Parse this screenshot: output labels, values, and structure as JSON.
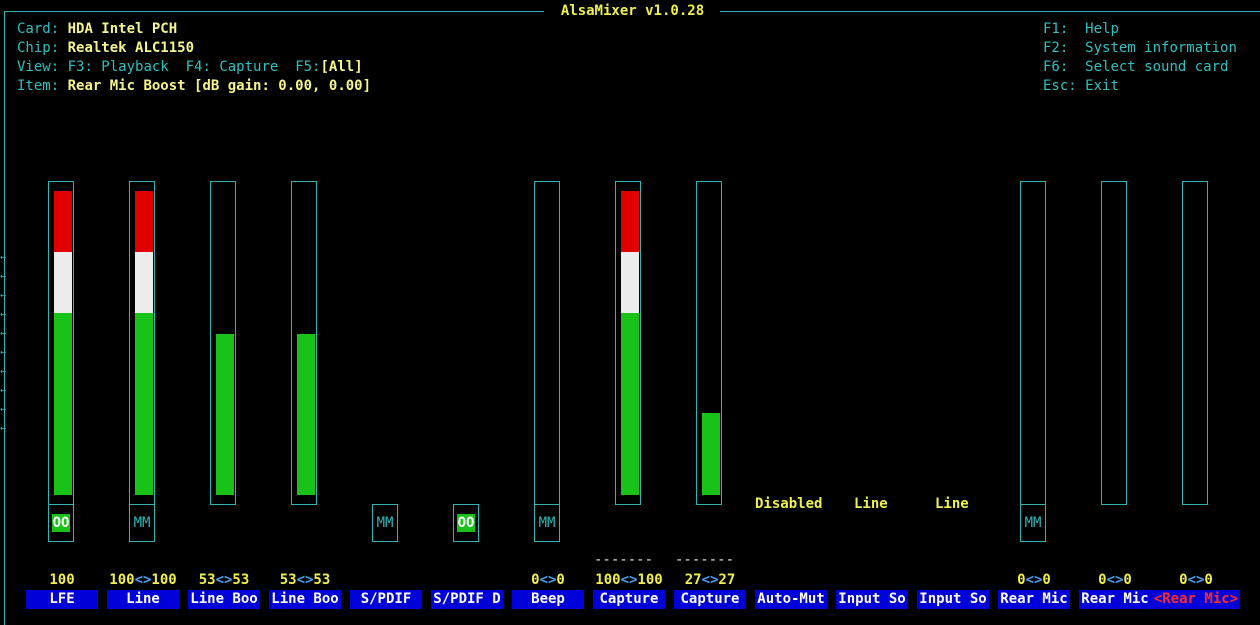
{
  "window": {
    "title": "AlsaMixer v1.0.28"
  },
  "info": {
    "card_label": "Card:",
    "card_value": "HDA Intel PCH",
    "chip_label": "Chip:",
    "chip_value": "Realtek ALC1150",
    "view_label": "View:",
    "view_playback": "F3: Playback",
    "view_capture": "F4: Capture",
    "view_all_key": "F5:",
    "view_all_value": "[All]",
    "item_label": "Item:",
    "item_value": "Rear Mic Boost [dB gain: 0.00, 0.00]"
  },
  "help": [
    {
      "key": "F1:",
      "text": "Help"
    },
    {
      "key": "F2:",
      "text": "System information"
    },
    {
      "key": "F6:",
      "text": "Select sound card"
    },
    {
      "key": "Esc:",
      "text": "Exit"
    }
  ],
  "scroll_mark": "←",
  "colors": {
    "frame": "#2fb4b4",
    "red": "#e00000",
    "white": "#ececec",
    "green": "#19c219",
    "label_bg": "#0000d8",
    "value": "#f0f04a"
  },
  "channels": [
    {
      "label": "LFE",
      "volume": "100",
      "level": 1.0
    },
    {
      "label": "Line",
      "vol_left": "100",
      "vol_sep": "<>",
      "vol_right": "100",
      "level": 1.0
    },
    {
      "label": "Line Boo",
      "vol_left": "53",
      "vol_sep": "<>",
      "vol_right": "53",
      "level": 0.53
    },
    {
      "label": "Line Boo",
      "vol_left": "53",
      "vol_sep": "<>",
      "vol_right": "53",
      "level": 0.53
    },
    {
      "label": "S/PDIF",
      "switch": "MM"
    },
    {
      "label": "S/PDIF D",
      "switch": "OO"
    },
    {
      "label": "Beep",
      "vol_left": "0",
      "vol_sep": "<>",
      "vol_right": "0",
      "level": 0.0
    },
    {
      "label": "Capture",
      "vol_left": "100",
      "vol_sep": "<>",
      "vol_right": "100",
      "level": 1.0,
      "capture_mark": "-------"
    },
    {
      "label": "Capture",
      "vol_left": "27",
      "vol_sep": "<>",
      "vol_right": "27",
      "level": 0.27,
      "capture_mark": "-------"
    },
    {
      "label": "Auto-Mut",
      "enum": "Disabled"
    },
    {
      "label": "Input So",
      "enum": "Line"
    },
    {
      "label": "Input So",
      "enum": "Line"
    },
    {
      "label": "Rear Mic",
      "vol_left": "0",
      "vol_sep": "<>",
      "vol_right": "0",
      "level": 0.0
    },
    {
      "label": "Rear Mic",
      "vol_left": "0",
      "vol_sep": "<>",
      "vol_right": "0",
      "level": 0.0
    },
    {
      "label": "<Rear Mic>",
      "vol_left": "0",
      "vol_sep": "<>",
      "vol_right": "0",
      "level": 0.0
    }
  ],
  "switch_labels": {
    "lfe": "OO",
    "line": "MM",
    "beep": "MM",
    "rear_mic_1": "MM"
  }
}
